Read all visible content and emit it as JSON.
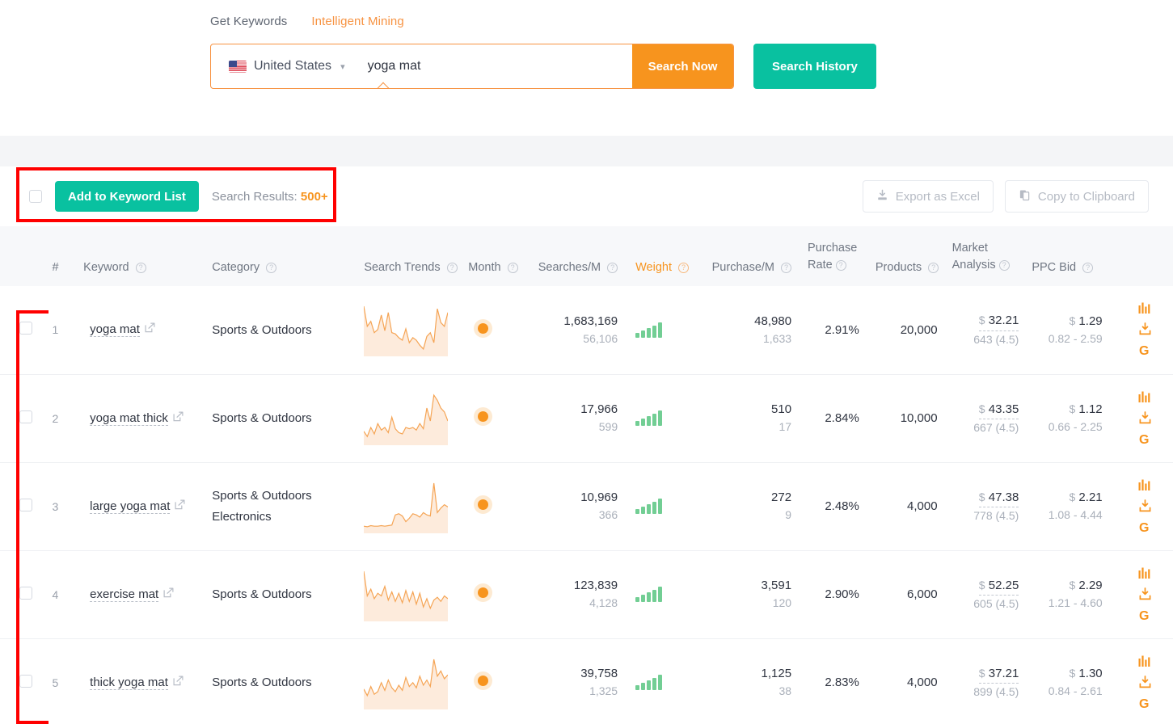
{
  "header": {
    "tabs": [
      {
        "label": "Get Keywords",
        "active": false
      },
      {
        "label": "Intelligent Mining",
        "active": true
      }
    ],
    "country": "United States",
    "keyword_value": "yoga mat",
    "keyword_placeholder": "",
    "search_now_label": "Search Now",
    "search_history_label": "Search History"
  },
  "toolbar": {
    "add_label": "Add to Keyword List",
    "results_label": "Search Results:",
    "results_count": "500+",
    "export_label": "Export as Excel",
    "copy_label": "Copy to Clipboard"
  },
  "table": {
    "columns": [
      {
        "label": "#",
        "help": false
      },
      {
        "label": "Keyword",
        "help": true
      },
      {
        "label": "Category",
        "help": true
      },
      {
        "label": "Search Trends",
        "help": true
      },
      {
        "label": "Month",
        "help": true
      },
      {
        "label": "Searches/M",
        "help": true
      },
      {
        "label": "Weight",
        "help": true,
        "accent": true
      },
      {
        "label": "Purchase/M",
        "help": true
      },
      {
        "label": "Purchase Rate",
        "help": true
      },
      {
        "label": "Products",
        "help": true
      },
      {
        "label": "Market Analysis",
        "help": true
      },
      {
        "label": "PPC Bid",
        "help": true
      }
    ],
    "rows": [
      {
        "index": "1",
        "keyword": "yoga mat",
        "categories": [
          "Sports & Outdoors"
        ],
        "trend": [
          72,
          40,
          48,
          30,
          35,
          58,
          33,
          62,
          30,
          28,
          22,
          18,
          36,
          14,
          22,
          18,
          10,
          4,
          24,
          30,
          14,
          68,
          46,
          40,
          62
        ],
        "searches_main": "1,683,169",
        "searches_sub": "56,106",
        "weight": [
          6,
          9,
          12,
          15,
          19
        ],
        "purchase_main": "48,980",
        "purchase_sub": "1,633",
        "purchase_rate": "2.91%",
        "products": "20,000",
        "market_price": "32.21",
        "market_sub": "643 (4.5)",
        "ppc_price": "1.29",
        "ppc_sub": "0.82 - 2.59"
      },
      {
        "index": "2",
        "keyword": "yoga mat thick",
        "categories": [
          "Sports & Outdoors"
        ],
        "trend": [
          14,
          6,
          20,
          10,
          26,
          16,
          20,
          12,
          36,
          18,
          12,
          10,
          20,
          18,
          20,
          16,
          26,
          18,
          50,
          30,
          70,
          62,
          50,
          44,
          30
        ],
        "searches_main": "17,966",
        "searches_sub": "599",
        "weight": [
          6,
          9,
          12,
          15,
          19
        ],
        "purchase_main": "510",
        "purchase_sub": "17",
        "purchase_rate": "2.84%",
        "products": "10,000",
        "market_price": "43.35",
        "market_sub": "667 (4.5)",
        "ppc_price": "1.12",
        "ppc_sub": "0.66 - 2.25"
      },
      {
        "index": "3",
        "keyword": "large yoga mat",
        "categories": [
          "Sports & Outdoors",
          "Electronics"
        ],
        "trend": [
          4,
          3,
          5,
          4,
          4,
          5,
          4,
          5,
          6,
          24,
          26,
          22,
          12,
          18,
          26,
          24,
          20,
          28,
          24,
          22,
          80,
          28,
          36,
          42,
          38
        ],
        "searches_main": "10,969",
        "searches_sub": "366",
        "weight": [
          6,
          9,
          12,
          15,
          19
        ],
        "purchase_main": "272",
        "purchase_sub": "9",
        "purchase_rate": "2.48%",
        "products": "4,000",
        "market_price": "47.38",
        "market_sub": "778 (4.5)",
        "ppc_price": "2.21",
        "ppc_sub": "1.08 - 4.44"
      },
      {
        "index": "4",
        "keyword": "exercise mat",
        "categories": [
          "Sports & Outdoors"
        ],
        "trend": [
          66,
          30,
          40,
          26,
          34,
          30,
          44,
          24,
          36,
          22,
          34,
          20,
          38,
          22,
          36,
          18,
          34,
          14,
          26,
          12,
          24,
          28,
          22,
          30,
          26
        ],
        "searches_main": "123,839",
        "searches_sub": "4,128",
        "weight": [
          6,
          9,
          12,
          15,
          19
        ],
        "purchase_main": "3,591",
        "purchase_sub": "120",
        "purchase_rate": "2.90%",
        "products": "6,000",
        "market_price": "52.25",
        "market_sub": "605 (4.5)",
        "ppc_price": "2.29",
        "ppc_sub": "1.21 - 4.60"
      },
      {
        "index": "5",
        "keyword": "thick yoga mat",
        "categories": [
          "Sports & Outdoors"
        ],
        "trend": [
          24,
          14,
          28,
          16,
          20,
          34,
          22,
          38,
          26,
          20,
          30,
          22,
          42,
          28,
          34,
          26,
          44,
          30,
          38,
          28,
          70,
          44,
          52,
          40,
          46
        ],
        "searches_main": "39,758",
        "searches_sub": "1,325",
        "weight": [
          6,
          9,
          12,
          15,
          19
        ],
        "purchase_main": "1,125",
        "purchase_sub": "38",
        "purchase_rate": "2.83%",
        "products": "4,000",
        "market_price": "37.21",
        "market_sub": "899 (4.5)",
        "ppc_price": "1.30",
        "ppc_sub": "0.84 - 2.61"
      }
    ]
  },
  "icons": {
    "export": "download-icon",
    "copy": "copy-icon",
    "row_chart": "bar-chart-icon",
    "row_download": "download-icon",
    "row_google": "google-icon",
    "external": "external-link-icon"
  },
  "colors": {
    "accent_orange": "#F7941E",
    "accent_teal": "#09C1A0",
    "weight_green": "#72CE94",
    "annotation_red": "#FF0000"
  }
}
